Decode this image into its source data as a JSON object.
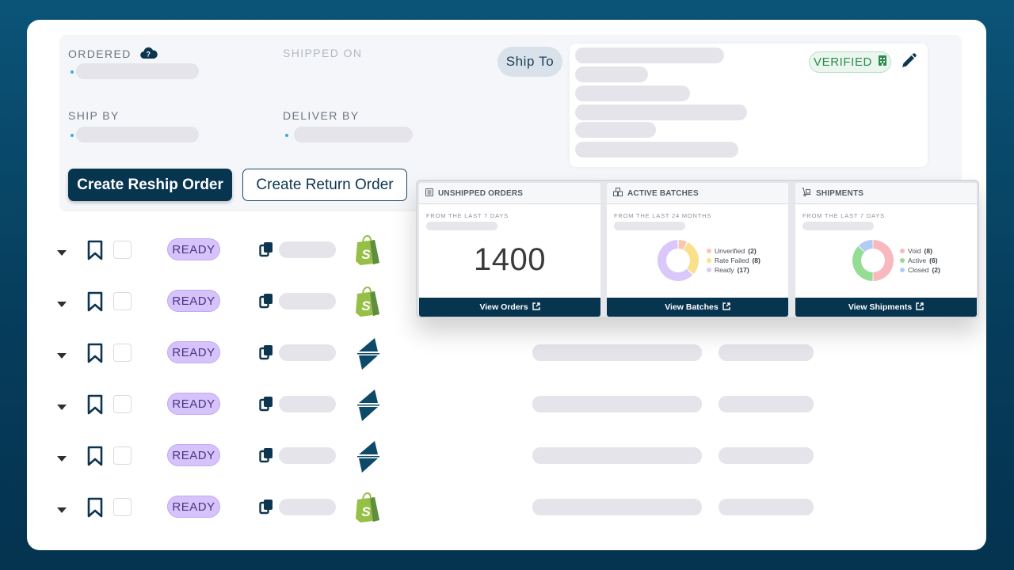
{
  "order_panel": {
    "ordered_label": "ORDERED",
    "shipped_on_label": "SHIPPED ON",
    "ship_by_label": "SHIP BY",
    "deliver_by_label": "DELIVER BY",
    "create_reship_label": "Create Reship Order",
    "create_return_label": "Create Return Order",
    "ship_to_label": "Ship To",
    "verified_label": "VERIFIED"
  },
  "rows": [
    {
      "status": "READY",
      "store": "shopify"
    },
    {
      "status": "READY",
      "store": "shopify"
    },
    {
      "status": "READY",
      "store": "shipstation"
    },
    {
      "status": "READY",
      "store": "shipstation"
    },
    {
      "status": "READY",
      "store": "shipstation"
    },
    {
      "status": "READY",
      "store": "shopify"
    }
  ],
  "widgets": {
    "unshipped": {
      "title": "UNSHIPPED ORDERS",
      "subtitle": "FROM THE LAST 7 DAYS",
      "value": "1400",
      "footer": "View Orders"
    },
    "batches": {
      "title": "ACTIVE BATCHES",
      "subtitle": "FROM THE LAST 24 MONTHS",
      "footer": "View Batches",
      "legend": [
        {
          "label": "Unverified",
          "count": "(2)",
          "color": "#f9c6b0"
        },
        {
          "label": "Rate Failed",
          "count": "(8)",
          "color": "#f9e08a"
        },
        {
          "label": "Ready",
          "count": "(17)",
          "color": "#d9c8f9"
        }
      ]
    },
    "shipments": {
      "title": "SHIPMENTS",
      "subtitle": "FROM THE LAST 7 DAYS",
      "footer": "View Shipments",
      "legend": [
        {
          "label": "Void",
          "count": "(8)",
          "color": "#f8b9be"
        },
        {
          "label": "Active",
          "count": "(6)",
          "color": "#95dd95"
        },
        {
          "label": "Closed",
          "count": "(2)",
          "color": "#b3ccf6"
        }
      ]
    }
  },
  "chart_data": [
    {
      "type": "pie",
      "title": "ACTIVE BATCHES",
      "categories": [
        "Unverified",
        "Rate Failed",
        "Ready"
      ],
      "values": [
        2,
        8,
        17
      ],
      "legend": "right"
    },
    {
      "type": "pie",
      "title": "SHIPMENTS",
      "categories": [
        "Void",
        "Active",
        "Closed"
      ],
      "values": [
        8,
        6,
        2
      ],
      "legend": "right"
    }
  ]
}
